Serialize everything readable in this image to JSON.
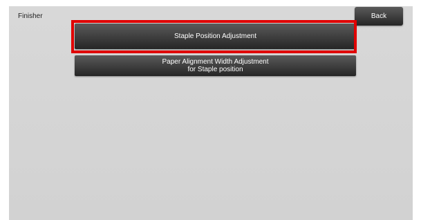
{
  "header": {
    "title": "Finisher",
    "back_label": "Back"
  },
  "menu": {
    "items": [
      {
        "lines": [
          "Staple Position Adjustment"
        ]
      },
      {
        "lines": [
          "Paper Alignment Width Adjustment",
          "for Staple position"
        ]
      }
    ]
  },
  "highlight": {
    "color": "#e00000",
    "target": "Staple Position Adjustment"
  }
}
